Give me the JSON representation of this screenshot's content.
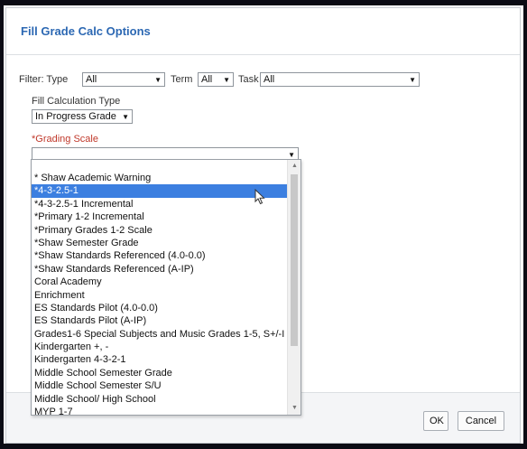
{
  "dialog": {
    "title": "Fill Grade Calc Options",
    "filter_label": "Filter: Type",
    "type_value": "All",
    "term_label": "Term",
    "term_value": "All",
    "task_label": "Task",
    "task_value": "All",
    "fill_calc_label": "Fill Calculation Type",
    "fill_calc_value": "In Progress Grade",
    "grading_scale_label": "*Grading Scale",
    "grading_scale_value": ""
  },
  "dropdown": {
    "items": [
      "* Shaw Academic Warning",
      "*4-3-2.5-1",
      "*4-3-2.5-1 Incremental",
      "*Primary 1-2 Incremental",
      "*Primary Grades 1-2 Scale",
      "*Shaw Semester Grade",
      "*Shaw Standards Referenced (4.0-0.0)",
      "*Shaw Standards Referenced (A-IP)",
      "Coral Academy",
      "Enrichment",
      "ES Standards Pilot (4.0-0.0)",
      "ES Standards Pilot (A-IP)",
      "Grades1-6 Special Subjects and Music Grades 1-5, S+/-I",
      "Kindergarten +, -",
      "Kindergarten 4-3-2-1",
      "Middle School Semester Grade",
      "Middle School Semester S/U",
      "Middle School/ High School",
      "MYP 1-7"
    ],
    "selected_index": 1
  },
  "footer": {
    "ok_label": "OK",
    "cancel_label": "Cancel"
  },
  "colors": {
    "title": "#2c68b3",
    "required": "#c0392b",
    "selection": "#3c7fe0"
  }
}
